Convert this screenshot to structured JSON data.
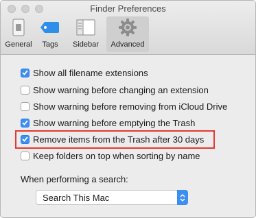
{
  "window": {
    "title": "Finder Preferences"
  },
  "toolbar": {
    "tabs": [
      {
        "label": "General",
        "icon": "general-icon"
      },
      {
        "label": "Tags",
        "icon": "tag-icon"
      },
      {
        "label": "Sidebar",
        "icon": "sidebar-icon"
      },
      {
        "label": "Advanced",
        "icon": "gear-icon",
        "selected": true
      }
    ]
  },
  "options": [
    {
      "label": "Show all filename extensions",
      "checked": true
    },
    {
      "label": "Show warning before changing an extension",
      "checked": false
    },
    {
      "label": "Show warning before removing from iCloud Drive",
      "checked": false
    },
    {
      "label": "Show warning before emptying the Trash",
      "checked": true
    },
    {
      "label": "Remove items from the Trash after 30 days",
      "checked": true,
      "highlighted": true
    },
    {
      "label": "Keep folders on top when sorting by name",
      "checked": false
    }
  ],
  "search": {
    "label": "When performing a search:",
    "selected": "Search This Mac"
  },
  "colors": {
    "accent": "#3c8ef3",
    "highlight": "#e8372e"
  }
}
